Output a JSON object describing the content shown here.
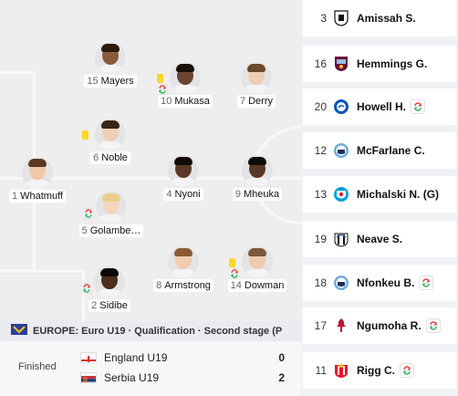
{
  "lineup": [
    {
      "number": "15",
      "name": "Mayers",
      "skin": "#8a5a3c",
      "hair": "#2a1a10",
      "yellow_card": false,
      "substituted": false
    },
    {
      "number": "10",
      "name": "Mukasa",
      "skin": "#6a4530",
      "hair": "#1a1008",
      "yellow_card": true,
      "substituted": true
    },
    {
      "number": "7",
      "name": "Derry",
      "skin": "#f0cdb0",
      "hair": "#6a4a2a",
      "yellow_card": false,
      "substituted": false
    },
    {
      "number": "6",
      "name": "Noble",
      "skin": "#f2d0b8",
      "hair": "#3a2416",
      "yellow_card": true,
      "substituted": false
    },
    {
      "number": "1",
      "name": "Whatmuff",
      "skin": "#f0c8a8",
      "hair": "#5a3a22",
      "yellow_card": false,
      "substituted": false
    },
    {
      "number": "4",
      "name": "Nyoni",
      "skin": "#5a3a26",
      "hair": "#120a06",
      "yellow_card": false,
      "substituted": false
    },
    {
      "number": "9",
      "name": "Mheuka",
      "skin": "#5a3826",
      "hair": "#120a06",
      "yellow_card": false,
      "substituted": false
    },
    {
      "number": "5",
      "name": "Golambe…",
      "skin": "#f4d6c0",
      "hair": "#e8cf8a",
      "yellow_card": false,
      "substituted": true
    },
    {
      "number": "2",
      "name": "Sidibe",
      "skin": "#4a2e1e",
      "hair": "#100806",
      "yellow_card": false,
      "substituted": true
    },
    {
      "number": "8",
      "name": "Armstrong",
      "skin": "#f2ccb0",
      "hair": "#8a5a34",
      "yellow_card": false,
      "substituted": false
    },
    {
      "number": "14",
      "name": "Dowman",
      "skin": "#f0cab0",
      "hair": "#7a5a3a",
      "yellow_card": true,
      "substituted": true
    }
  ],
  "match": {
    "competition": "EUROPE: Euro U19 · Qualification · Second stage (P",
    "status": "Finished",
    "home": {
      "name": "England U19",
      "score": "0",
      "flag_icon": "england-flag-icon"
    },
    "away": {
      "name": "Serbia U19",
      "score": "2",
      "flag_icon": "serbia-flag-icon"
    }
  },
  "substitutes": [
    {
      "number": "3",
      "name": "Amissah S.",
      "club_icon": "fulham-crest-icon",
      "subbed_on": false
    },
    {
      "number": "16",
      "name": "Hemmings G.",
      "club_icon": "aston-villa-crest-icon",
      "subbed_on": false
    },
    {
      "number": "20",
      "name": "Howell H.",
      "club_icon": "brighton-crest-icon",
      "subbed_on": true
    },
    {
      "number": "12",
      "name": "McFarlane C.",
      "club_icon": "man-city-crest-icon",
      "subbed_on": false
    },
    {
      "number": "13",
      "name": "Michalski N. (G)",
      "club_icon": "blackburn-crest-icon",
      "subbed_on": false
    },
    {
      "number": "19",
      "name": "Neave S.",
      "club_icon": "newcastle-crest-icon",
      "subbed_on": false
    },
    {
      "number": "18",
      "name": "Nfonkeu B.",
      "club_icon": "man-city-crest-icon",
      "subbed_on": true
    },
    {
      "number": "17",
      "name": "Ngumoha R.",
      "club_icon": "liverpool-crest-icon",
      "subbed_on": true
    },
    {
      "number": "11",
      "name": "Rigg C.",
      "club_icon": "sunderland-crest-icon",
      "subbed_on": true
    }
  ],
  "colors": {
    "accent_sub": "#e63b3b",
    "accent_sub_in": "#2fb35a",
    "yellow_card": "#ffd628",
    "pitch": "#eeeeef"
  }
}
